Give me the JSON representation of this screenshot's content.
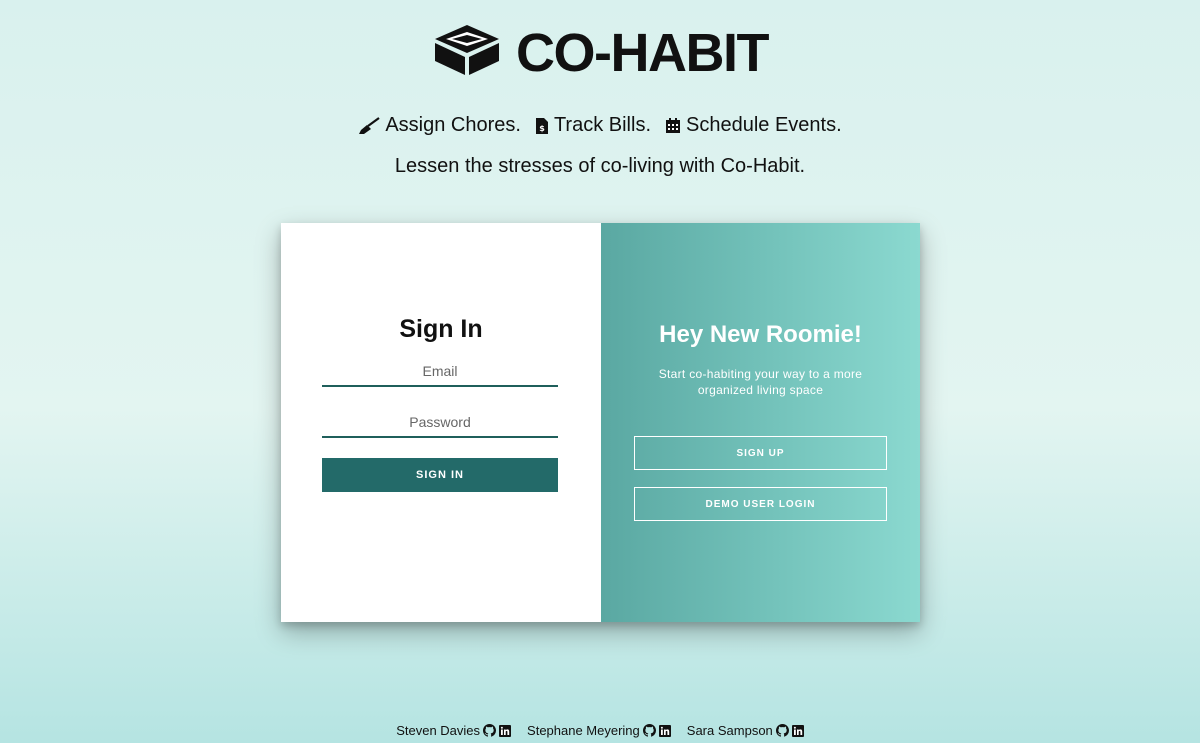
{
  "brand": {
    "name": "CO-HABIT",
    "logo_icon": "box-icon"
  },
  "tagline": {
    "items": [
      {
        "icon": "broom-icon",
        "label": "Assign Chores."
      },
      {
        "icon": "invoice-icon",
        "label": "Track Bills."
      },
      {
        "icon": "calendar-icon",
        "label": "Schedule Events."
      }
    ],
    "subline": "Lessen the stresses of co-living with Co-Habit."
  },
  "signin": {
    "title": "Sign In",
    "email_placeholder": "Email",
    "password_placeholder": "Password",
    "button_label": "SIGN IN"
  },
  "welcome": {
    "title": "Hey New Roomie!",
    "subtitle": "Start co-habiting your way to a more organized living space",
    "signup_label": "SIGN UP",
    "demo_label": "DEMO USER LOGIN"
  },
  "footer": {
    "authors": [
      {
        "name": "Steven Davies",
        "icons": [
          "github-icon",
          "linkedin-icon"
        ]
      },
      {
        "name": "Stephane Meyering",
        "icons": [
          "github-icon",
          "linkedin-icon"
        ]
      },
      {
        "name": "Sara Sampson",
        "icons": [
          "github-icon",
          "linkedin-icon"
        ]
      }
    ]
  },
  "colors": {
    "primary": "#236a69",
    "panel_gradient_start": "#5aa8a2",
    "panel_gradient_end": "#8bd9d0",
    "background_top": "#d9f1ee",
    "background_bottom": "#b5e4e2"
  }
}
